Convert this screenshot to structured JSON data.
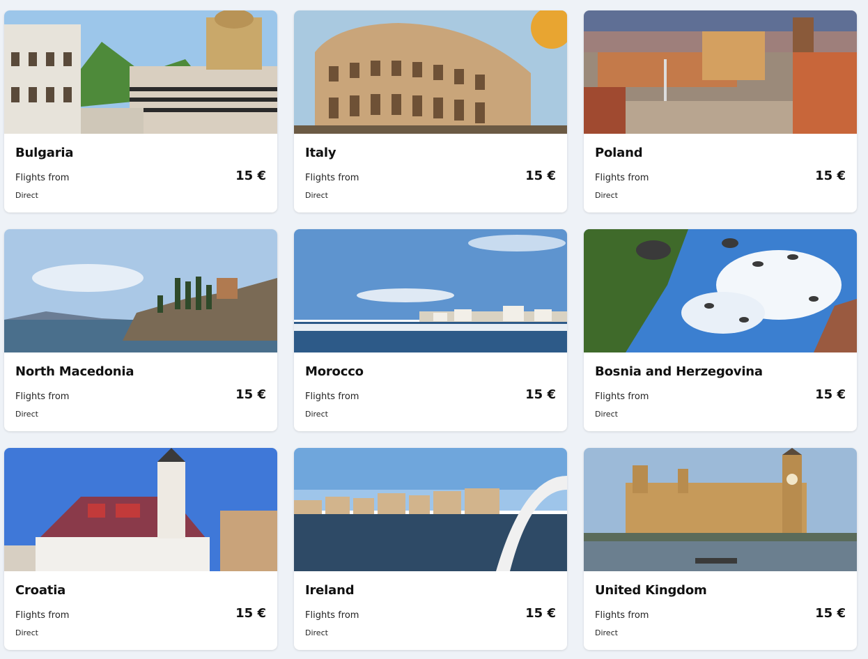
{
  "cards": [
    {
      "name": "Bulgaria",
      "flights_label": "Flights from",
      "price": "15 €",
      "stops": "Direct"
    },
    {
      "name": "Italy",
      "flights_label": "Flights from",
      "price": "15 €",
      "stops": "Direct"
    },
    {
      "name": "Poland",
      "flights_label": "Flights from",
      "price": "15 €",
      "stops": "Direct"
    },
    {
      "name": "North Macedonia",
      "flights_label": "Flights from",
      "price": "15 €",
      "stops": "Direct"
    },
    {
      "name": "Morocco",
      "flights_label": "Flights from",
      "price": "15 €",
      "stops": "Direct"
    },
    {
      "name": "Bosnia and Herzegovina",
      "flights_label": "Flights from",
      "price": "15 €",
      "stops": "Direct"
    },
    {
      "name": "Croatia",
      "flights_label": "Flights from",
      "price": "15 €",
      "stops": "Direct"
    },
    {
      "name": "Ireland",
      "flights_label": "Flights from",
      "price": "15 €",
      "stops": "Direct"
    },
    {
      "name": "United Kingdom",
      "flights_label": "Flights from",
      "price": "15 €",
      "stops": "Direct"
    }
  ]
}
